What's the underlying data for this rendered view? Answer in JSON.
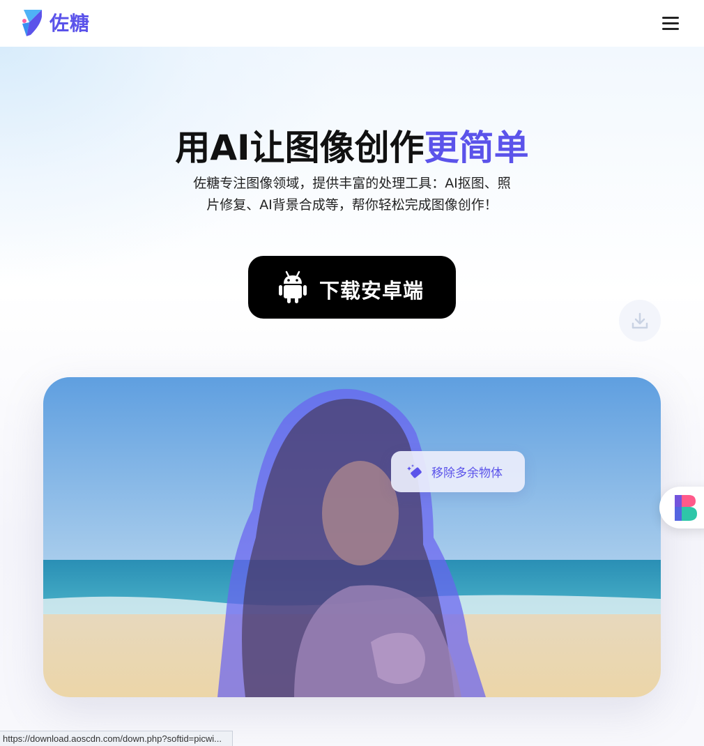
{
  "header": {
    "brand_name": "佐糖",
    "logo_icon": "zuotang-logo-icon",
    "menu_icon": "hamburger-menu-icon"
  },
  "hero": {
    "title_main": "用AI让图像创作",
    "title_accent": "更简单",
    "subtitle": "佐糖专注图像领域，提供丰富的处理工具：AI抠图、照片修复、AI背景合成等，帮你轻松完成图像创作！",
    "download_button_label": "下载安卓端",
    "download_button_icon": "android-icon",
    "float_download_icon": "download-icon"
  },
  "showcase": {
    "chip_label": "移除多余物体",
    "chip_icon": "eraser-sparkle-icon",
    "side_app_icon": "app-logo-icon"
  },
  "status_bar": {
    "url": "https://download.aoscdn.com/down.php?softid=picwi..."
  },
  "colors": {
    "accent": "#5b53ea",
    "button_bg": "#000000",
    "selection_overlay": "#6a62f0"
  }
}
